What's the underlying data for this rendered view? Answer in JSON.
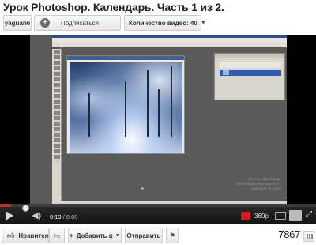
{
  "video": {
    "title": "Урок Photoshop. Календарь. Часть 1 из 2."
  },
  "channel_bar": {
    "channel_name": "yaguan6",
    "subscribe_label": "Подписаться",
    "video_count_label": "Количество видео: 40"
  },
  "player": {
    "current_time": "0:13",
    "duration": "6:00",
    "progress_fraction": 0.036,
    "quality": "360p",
    "played_color": "#c4302b"
  },
  "watermark": {
    "lines": [
      "Оксана Артемова",
      "www.photoshop-master.ru",
      "Copyright © 2010"
    ]
  },
  "actions": {
    "like_label": "Нравится",
    "add_label": "Добавить в",
    "share_label": "Отправить",
    "view_count": "7867"
  },
  "icons": {
    "like": "thumb-up-icon",
    "dislike": "thumb-down-icon",
    "add": "plus-icon",
    "flag": "flag-icon",
    "stats": "bar-chart-icon",
    "play": "play-icon",
    "volume": "volume-icon",
    "fullscreen": "fullscreen-icon"
  }
}
